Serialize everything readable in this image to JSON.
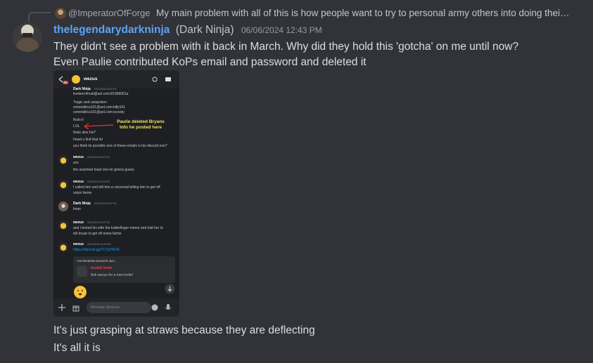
{
  "reply": {
    "username": "@ImperatorOfForge",
    "text": "My main problem with all of this is how people want to try to personal army others into doing thei…"
  },
  "message": {
    "username": "thelegendarydarkninja",
    "nickname": "(Dark Ninja)",
    "timestamp": "06/06/2024 12:43 PM",
    "lines": [
      "They didn't see a problem with it back in March. Why did they hold this 'gotcha' on me until now?",
      "Even Paulie contributed KoPs email and password and deleted it"
    ],
    "after_lines": [
      "It's just grasping at straws because they are deflecting",
      "It's all it is"
    ]
  },
  "screenshot": {
    "header_title": "wezus",
    "header_badge": "99",
    "top_name": "Dark Ninja",
    "top_time": "03/13/2024 8:23 PM",
    "top_lines": [
      "liveleerr4mail@aol.com:81989061a",
      "Tragic and outspoken",
      "xxmetallica101@aol.com:billy101",
      "xxmetallica101@aol.com:scooby",
      "thats it",
      "LOL",
      "thats also his?",
      "howd u find that lol",
      "you think its possible one of these emails is his discord one?"
    ],
    "annotation": "Paulie deleted Bryans Info he posted here",
    "messages": [
      {
        "name": "wezus",
        "time": "03/13/2024 8:26 PM",
        "lines": [
          "yes",
          "the unarmed toast one im gonna guess"
        ]
      },
      {
        "name": "wezus",
        "time": "03/13/2024 8:29 PM",
        "lines": [
          "I called him and left him a voicemail telling him to get off",
          "onion farms"
        ]
      },
      {
        "name": "Dark Ninja",
        "time": "03/13/2024 8:29 PM",
        "lines": [
          "lmao"
        ]
      },
      {
        "name": "wezus",
        "time": "03/13/2024 8:29 PM",
        "lines": [
          "and I texted his wife the butterfinger meme and told her to",
          "tell bryan to get off onion farms"
        ]
      },
      {
        "name": "wezus",
        "time": "03/13/2024 10:09 PM",
        "lines": [
          "https://discord.gg/TC7gYNCA"
        ]
      }
    ],
    "invite": {
      "heading": "YOU RECEIVED AN INVITE, BUT...",
      "title": "Invalid Invite",
      "subtitle": "Ask wezus for a new invite!"
    },
    "composer_placeholder": "Message @wezus"
  }
}
